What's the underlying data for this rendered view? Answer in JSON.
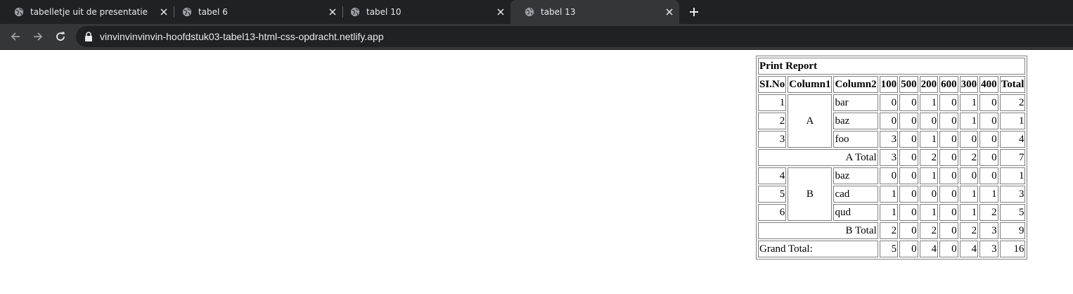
{
  "browser": {
    "tabs": [
      {
        "title": "tabelletje uit de presentatie",
        "active": false
      },
      {
        "title": "tabel 6",
        "active": false
      },
      {
        "title": "tabel 10",
        "active": false
      },
      {
        "title": "tabel 13",
        "active": true
      }
    ],
    "url": "vinvinvinvinvin-hoofdstuk03-tabel13-html-css-opdracht.netlify.app",
    "colors": {
      "tabstrip": "#202124",
      "active_tab": "#35363a",
      "omnibox": "#202124",
      "text": "#e8eaed"
    }
  },
  "report": {
    "title": "Print Report",
    "headers": [
      "SI.No",
      "Column1",
      "Column2",
      "100",
      "500",
      "200",
      "600",
      "300",
      "400",
      "Total"
    ],
    "groups": [
      {
        "name": "A",
        "rows": [
          {
            "si": "1",
            "col2": "bar",
            "vals": [
              "0",
              "0",
              "1",
              "0",
              "1",
              "0"
            ],
            "total": "2"
          },
          {
            "si": "2",
            "col2": "baz",
            "vals": [
              "0",
              "0",
              "0",
              "0",
              "1",
              "0"
            ],
            "total": "1"
          },
          {
            "si": "3",
            "col2": "foo",
            "vals": [
              "3",
              "0",
              "1",
              "0",
              "0",
              "0"
            ],
            "total": "4"
          }
        ],
        "subtotal_label": "A Total",
        "subtotal_vals": [
          "3",
          "0",
          "2",
          "0",
          "2",
          "0"
        ],
        "subtotal_total": "7"
      },
      {
        "name": "B",
        "rows": [
          {
            "si": "4",
            "col2": "baz",
            "vals": [
              "0",
              "0",
              "1",
              "0",
              "0",
              "0"
            ],
            "total": "1"
          },
          {
            "si": "5",
            "col2": "cad",
            "vals": [
              "1",
              "0",
              "0",
              "0",
              "1",
              "1"
            ],
            "total": "3"
          },
          {
            "si": "6",
            "col2": "qud",
            "vals": [
              "1",
              "0",
              "1",
              "0",
              "1",
              "2"
            ],
            "total": "5"
          }
        ],
        "subtotal_label": "B Total",
        "subtotal_vals": [
          "2",
          "0",
          "2",
          "0",
          "2",
          "3"
        ],
        "subtotal_total": "9"
      }
    ],
    "grand_total_label": "Grand Total:",
    "grand_total_vals": [
      "5",
      "0",
      "4",
      "0",
      "4",
      "3"
    ],
    "grand_total_total": "16"
  }
}
